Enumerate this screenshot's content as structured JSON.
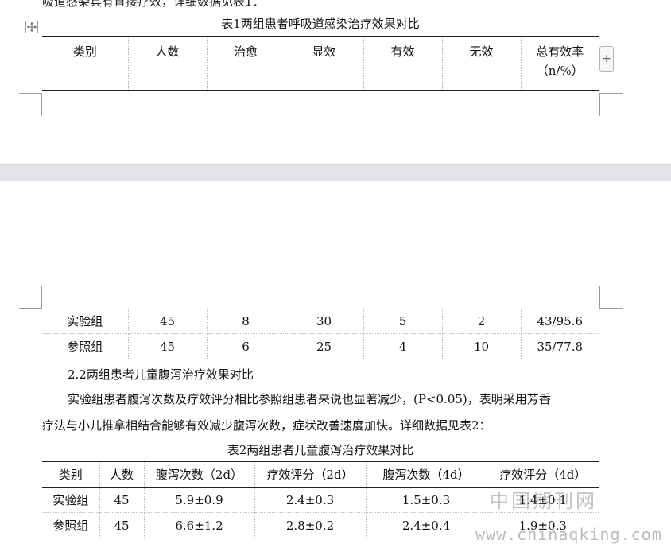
{
  "top_cut_line": "吸道感染具有直接疗效，详细数据见表1：",
  "table1": {
    "caption": "表1两组患者呼吸道感染治疗效果对比",
    "headers": [
      "类别",
      "人数",
      "治愈",
      "显效",
      "有效",
      "无效",
      "总有效率"
    ],
    "header_unit": "（n/%）",
    "rows": [
      [
        "实验组",
        "45",
        "8",
        "30",
        "5",
        "2",
        "43/95.6"
      ],
      [
        "参照组",
        "45",
        "6",
        "25",
        "4",
        "10",
        "35/77.8"
      ]
    ]
  },
  "section_heading": "2.2两组患者儿童腹泻治疗效果对比",
  "paragraph": {
    "line1": "实验组患者腹泻次数及疗效评分相比参照组患者来说也显著减少，(P<0.05)，表明采用芳香",
    "line2": "疗法与小儿推拿相结合能够有效减少腹泻次数，症状改善速度加快。详细数据见表2："
  },
  "table2": {
    "caption": "表2两组患者儿童腹泻治疗效果对比",
    "headers": [
      "类别",
      "人数",
      "腹泻次数（2d）",
      "疗效评分（2d）",
      "腹泻次数（4d）",
      "疗效评分（4d）"
    ],
    "rows": [
      [
        "实验组",
        "45",
        "5.9±0.9",
        "2.4±0.3",
        "1.5±0.3",
        "1.4±0.1"
      ],
      [
        "参照组",
        "45",
        "6.6±1.2",
        "2.8±0.2",
        "2.4±0.4",
        "1.9±0.3"
      ]
    ]
  },
  "watermark": {
    "cn": "中国期刊网",
    "url": "www.chinaqking.com"
  },
  "icons": {
    "table_move_handle": "move-arrows-icon",
    "table_add_handle": "plus-icon"
  },
  "colors": {
    "page_background": "#ffffff",
    "page_gap": "#e1e3e6",
    "table_rule": "#222222",
    "dotted_grid": "#b8b8b8"
  }
}
